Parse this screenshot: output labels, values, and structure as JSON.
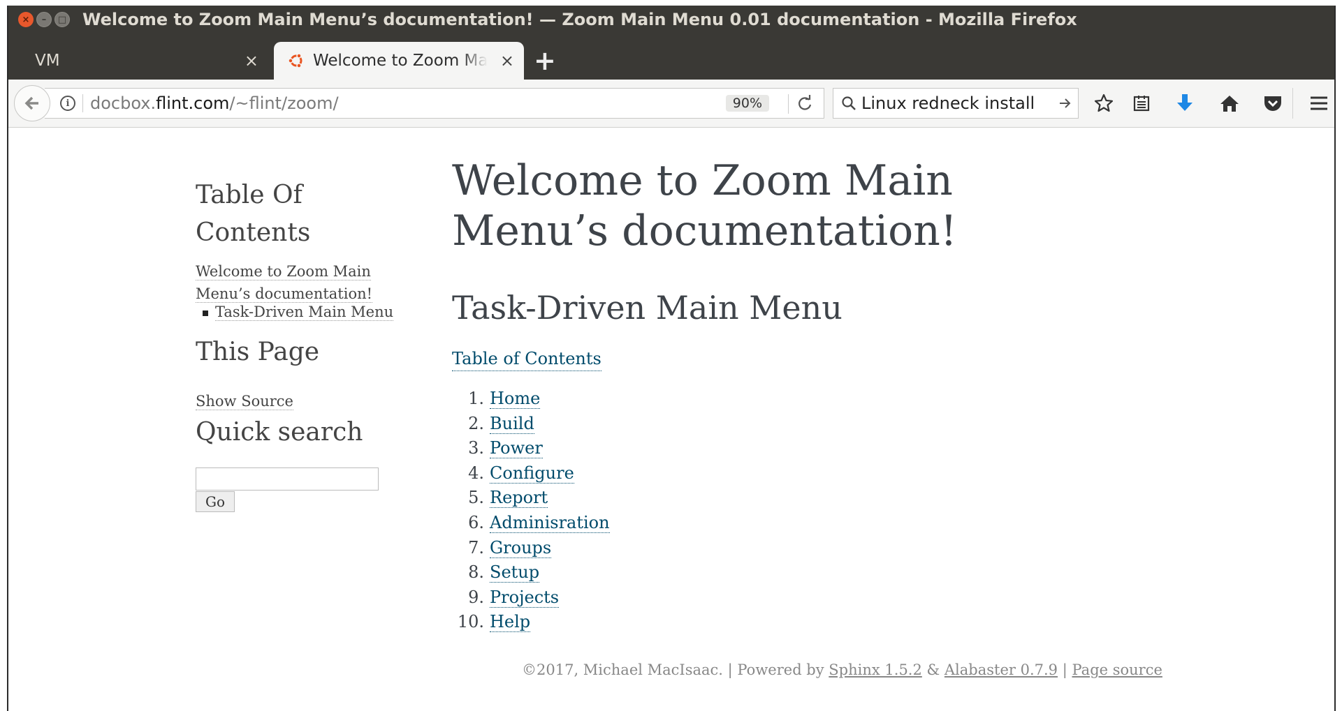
{
  "window": {
    "title": "Welcome to Zoom Main Menu’s documentation! — Zoom Main Menu 0.01 documentation - Mozilla Firefox",
    "buttons": {
      "close": "×",
      "minimize": "–",
      "maximize": "□"
    }
  },
  "tabs": [
    {
      "label": "VM",
      "close": "×",
      "active": false
    },
    {
      "label": "Welcome to Zoom Main Menu’s documentation!",
      "close": "×",
      "active": true
    }
  ],
  "new_tab": "+",
  "navbar": {
    "url_prefix": "docbox.",
    "url_host": "flint.com",
    "url_path": "/~flint/zoom/",
    "zoom_level": "90%",
    "search_value": "Linux redneck install"
  },
  "sidebar": {
    "toc_heading": "Table Of Contents",
    "toc_link_line1": "Welcome to Zoom Main",
    "toc_link_line2": "Menu’s documentation!",
    "toc_sub_item": "Task-Driven Main Menu",
    "this_page_heading": "This Page",
    "show_source": "Show Source",
    "quick_search_heading": "Quick search",
    "search_input_value": "",
    "go_button": "Go"
  },
  "main": {
    "title": "Welcome to Zoom Main Menu’s documentation!",
    "section_title": "Task-Driven Main Menu",
    "toc_caption": "Table of Contents",
    "items": [
      {
        "num": "1.",
        "label": "Home"
      },
      {
        "num": "2.",
        "label": "Build"
      },
      {
        "num": "3.",
        "label": "Power"
      },
      {
        "num": "4.",
        "label": "Configure"
      },
      {
        "num": "5.",
        "label": "Report"
      },
      {
        "num": "6.",
        "label": "Adminisration"
      },
      {
        "num": "7.",
        "label": "Groups"
      },
      {
        "num": "8.",
        "label": "Setup"
      },
      {
        "num": "9.",
        "label": "Projects"
      },
      {
        "num": "10.",
        "label": "Help"
      }
    ]
  },
  "footer": {
    "copyright": "©2017, Michael MacIsaac. | Powered by ",
    "sphinx": "Sphinx 1.5.2",
    "amp": " & ",
    "alabaster": "Alabaster 0.7.9",
    "sep": " | ",
    "page_source": "Page source"
  },
  "colors": {
    "titlebar": "#3a3935",
    "link": "#004b6b",
    "close_button": "#e8582c",
    "downloads_arrow": "#1e88e5",
    "tab_favicon": "#e95420"
  }
}
